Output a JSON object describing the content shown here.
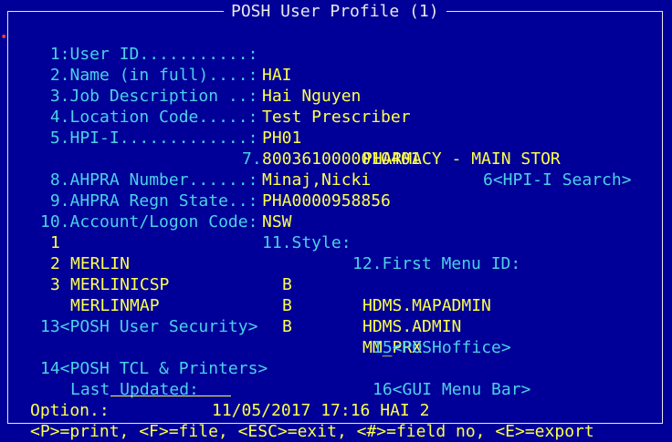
{
  "window": {
    "title": "POSH User Profile (1)"
  },
  "fields": {
    "user_id": {
      "label": " 1:User ID...........:",
      "value": "HAI"
    },
    "name": {
      "label": " 2.Name (in full)....:",
      "value": "Hai Nguyen"
    },
    "job_description": {
      "label": " 3.Job Description ..:",
      "value": "Test Prescriber"
    },
    "location_code": {
      "label": " 4.Location Code.....:",
      "value": "PH01",
      "description": "PHARMACY - MAIN STOR"
    },
    "hpi_i": {
      "label": " 5.HPI-I.............:",
      "value": "8003610000010401",
      "search_action": "6<HPI-I Search>"
    },
    "field7": {
      "label": "7.",
      "value": "Minaj,Nicki"
    },
    "ahpra_number": {
      "label": " 8.AHPRA Number......:",
      "value": "PHA0000958856"
    },
    "ahpra_state": {
      "label": " 9.AHPRA Regn State..:",
      "value": "NSW"
    }
  },
  "accounts_header": {
    "label10": "10.Account/Logon Code:",
    "label11": "11.Style:",
    "label12": "12.First Menu ID:"
  },
  "accounts": [
    {
      "num": "1",
      "code": "MERLIN",
      "style": "B",
      "menu": "HDMS.MAPADMIN"
    },
    {
      "num": "2",
      "code": "MERLINICSP",
      "style": "B",
      "menu": "HDMS.ADMIN"
    },
    {
      "num": "3",
      "code": "MERLINMAP",
      "style": "B",
      "menu": "MM_PRX"
    }
  ],
  "actions": {
    "a13": "13<POSH User Security>",
    "a15": "15<POSHoffice>",
    "a14": "14<POSH TCL & Printers>",
    "a16": "16<GUI Menu Bar>"
  },
  "last_updated": {
    "label": "Last Updated:",
    "value": "11/05/2017 17:16 HAI 2"
  },
  "prompt": {
    "label": "Option.:"
  },
  "footer": {
    "help": "<P>=print, <F>=file, <ESC>=exit, <#>=field no, <E>=export"
  },
  "colors": {
    "background": "#000098",
    "label": "#4cd0e8",
    "value": "#ffff4c",
    "border": "#e8e8e8"
  }
}
